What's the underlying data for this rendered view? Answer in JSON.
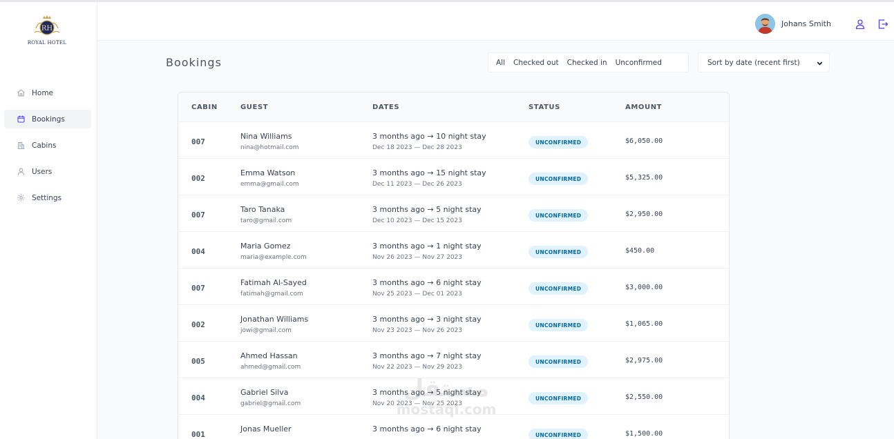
{
  "sidebar": {
    "logo": {
      "name": "ROYAL HOTEL",
      "monogram": "RH"
    },
    "items": [
      {
        "label": "Home",
        "icon": "home-icon"
      },
      {
        "label": "Bookings",
        "icon": "calendar-icon",
        "active": true
      },
      {
        "label": "Cabins",
        "icon": "building-icon"
      },
      {
        "label": "Users",
        "icon": "user-icon"
      },
      {
        "label": "Settings",
        "icon": "gear-icon"
      }
    ]
  },
  "header": {
    "user_name": "Johans Smith",
    "icons": [
      "account-icon",
      "logout-icon"
    ]
  },
  "main": {
    "title": "Bookings",
    "filters": [
      "All",
      "Checked out",
      "Checked in",
      "Unconfirmed"
    ],
    "sort_label": "Sort by date (recent first)",
    "columns": [
      "CABIN",
      "GUEST",
      "DATES",
      "STATUS",
      "AMOUNT"
    ],
    "rows": [
      {
        "cabin": "007",
        "name": "Nina Williams",
        "email": "nina@hotmail.com",
        "when": "3 months ago → 10 night stay",
        "range": "Dec 18 2023 — Dec 28 2023",
        "status": "UNCONFIRMED",
        "amount": "$6,050.00"
      },
      {
        "cabin": "002",
        "name": "Emma Watson",
        "email": "emma@gmail.com",
        "when": "3 months ago → 15 night stay",
        "range": "Dec 11 2023 — Dec 26 2023",
        "status": "UNCONFIRMED",
        "amount": "$5,325.00"
      },
      {
        "cabin": "007",
        "name": "Taro Tanaka",
        "email": "taro@gmail.com",
        "when": "3 months ago → 5 night stay",
        "range": "Dec 10 2023 — Dec 15 2023",
        "status": "UNCONFIRMED",
        "amount": "$2,950.00"
      },
      {
        "cabin": "004",
        "name": "Maria Gomez",
        "email": "maria@example.com",
        "when": "3 months ago → 1 night stay",
        "range": "Nov 26 2023 — Nov 27 2023",
        "status": "UNCONFIRMED",
        "amount": "$450.00"
      },
      {
        "cabin": "007",
        "name": "Fatimah Al-Sayed",
        "email": "fatimah@gmail.com",
        "when": "3 months ago → 6 night stay",
        "range": "Nov 25 2023 — Dec 01 2023",
        "status": "UNCONFIRMED",
        "amount": "$3,000.00"
      },
      {
        "cabin": "002",
        "name": "Jonathan Williams",
        "email": "jowi@gmail.com",
        "when": "3 months ago → 3 night stay",
        "range": "Nov 23 2023 — Nov 26 2023",
        "status": "UNCONFIRMED",
        "amount": "$1,065.00"
      },
      {
        "cabin": "005",
        "name": "Ahmed Hassan",
        "email": "ahmed@gmail.com",
        "when": "3 months ago → 7 night stay",
        "range": "Nov 22 2023 — Nov 29 2023",
        "status": "UNCONFIRMED",
        "amount": "$2,975.00"
      },
      {
        "cabin": "004",
        "name": "Gabriel Silva",
        "email": "gabriel@gmail.com",
        "when": "3 months ago → 5 night stay",
        "range": "Nov 20 2023 — Nov 25 2023",
        "status": "UNCONFIRMED",
        "amount": "$2,550.00"
      },
      {
        "cabin": "001",
        "name": "Jonas Mueller",
        "email": "",
        "when": "3 months ago → 6 night stay",
        "range": "",
        "status": "UNCONFIRMED",
        "amount": "$1,500.00"
      }
    ]
  },
  "watermark": {
    "arabic": "مستقل",
    "latin": "mostaql.com"
  },
  "colors": {
    "accent": "#4f46e5",
    "badge_bg": "#e0f2fe",
    "badge_text": "#0369a1"
  }
}
